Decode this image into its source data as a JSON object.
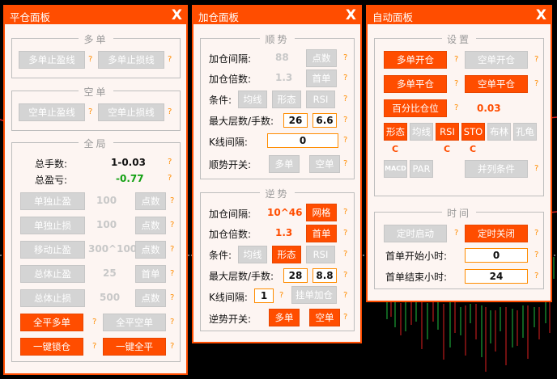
{
  "p1": {
    "title": "平仓面板",
    "close": "X",
    "s_multi": "多单",
    "tp_multi": "多单止盈线",
    "sl_multi": "多单止损线",
    "s_short": "空单",
    "tp_short": "空单止盈线",
    "sl_short": "空单止损线",
    "s_all": "全局",
    "total_lots_lbl": "总手数:",
    "total_lots": "1-0.03",
    "total_pl_lbl": "总盈亏:",
    "total_pl": "-0.77",
    "r1_btn": "单独止盈",
    "r1_val": "100",
    "r1_unit": "点数",
    "r2_btn": "单独止损",
    "r2_val": "100",
    "r2_unit": "点数",
    "r3_btn": "移动止盈",
    "r3_val": "300^100",
    "r3_unit": "点数",
    "r4_btn": "总体止盈",
    "r4_val": "25",
    "r4_unit": "首单",
    "r5_btn": "总体止损",
    "r5_val": "500",
    "r5_unit": "点数",
    "close_long": "全平多单",
    "close_short": "全平空单",
    "lock": "一键锁仓",
    "close_all": "一键全平",
    "q": "?"
  },
  "p2": {
    "title": "加仓面板",
    "close": "X",
    "s_trend": "顺势",
    "t_gap_lbl": "加仓间隔:",
    "t_gap": "88",
    "t_gap_unit": "点数",
    "t_mult_lbl": "加仓倍数:",
    "t_mult": "1.3",
    "t_mult_unit": "首单",
    "t_cond_lbl": "条件:",
    "t_c1": "均线",
    "t_c2": "形态",
    "t_c3": "RSI",
    "t_max_lbl": "最大层数/手数:",
    "t_max1": "26",
    "t_max2": "6.6",
    "t_k_lbl": "K线间隔:",
    "t_k": "0",
    "t_sw_lbl": "顺势开关:",
    "t_sw1": "多单",
    "t_sw2": "空单",
    "s_counter": "逆势",
    "c_gap_lbl": "加仓间隔:",
    "c_gap": "10^46",
    "c_gap_unit": "网格",
    "c_mult_lbl": "加仓倍数:",
    "c_mult": "1.3",
    "c_mult_unit": "首单",
    "c_cond_lbl": "条件:",
    "c_c1": "均线",
    "c_c2": "形态",
    "c_c3": "RSI",
    "c_max_lbl": "最大层数/手数:",
    "c_max1": "28",
    "c_max2": "8.8",
    "c_k_lbl": "K线间隔:",
    "c_k": "1",
    "c_k_btn": "挂单加仓",
    "c_sw_lbl": "逆势开关:",
    "c_sw1": "多单",
    "c_sw2": "空单",
    "q": "?"
  },
  "p3": {
    "title": "自动面板",
    "close": "X",
    "s_set": "设置",
    "open_long": "多单开仓",
    "open_short": "空单开仓",
    "flat_long": "多单平仓",
    "flat_short": "空单平仓",
    "pct": "百分比仓位",
    "pct_val": "0.03",
    "i1": "形态",
    "i2": "均线",
    "i3": "RSI",
    "i4": "STO",
    "i5": "布林",
    "i6": "孔龟",
    "mark": "C",
    "i7": "MACD",
    "i8": "PAR",
    "combine": "并列条件",
    "s_time": "时间",
    "timer_on": "定时启动",
    "timer_off": "定时关闭",
    "start_lbl": "首单开始小时:",
    "start_val": "0",
    "end_lbl": "首单结束小时:",
    "end_val": "24",
    "q": "?"
  }
}
